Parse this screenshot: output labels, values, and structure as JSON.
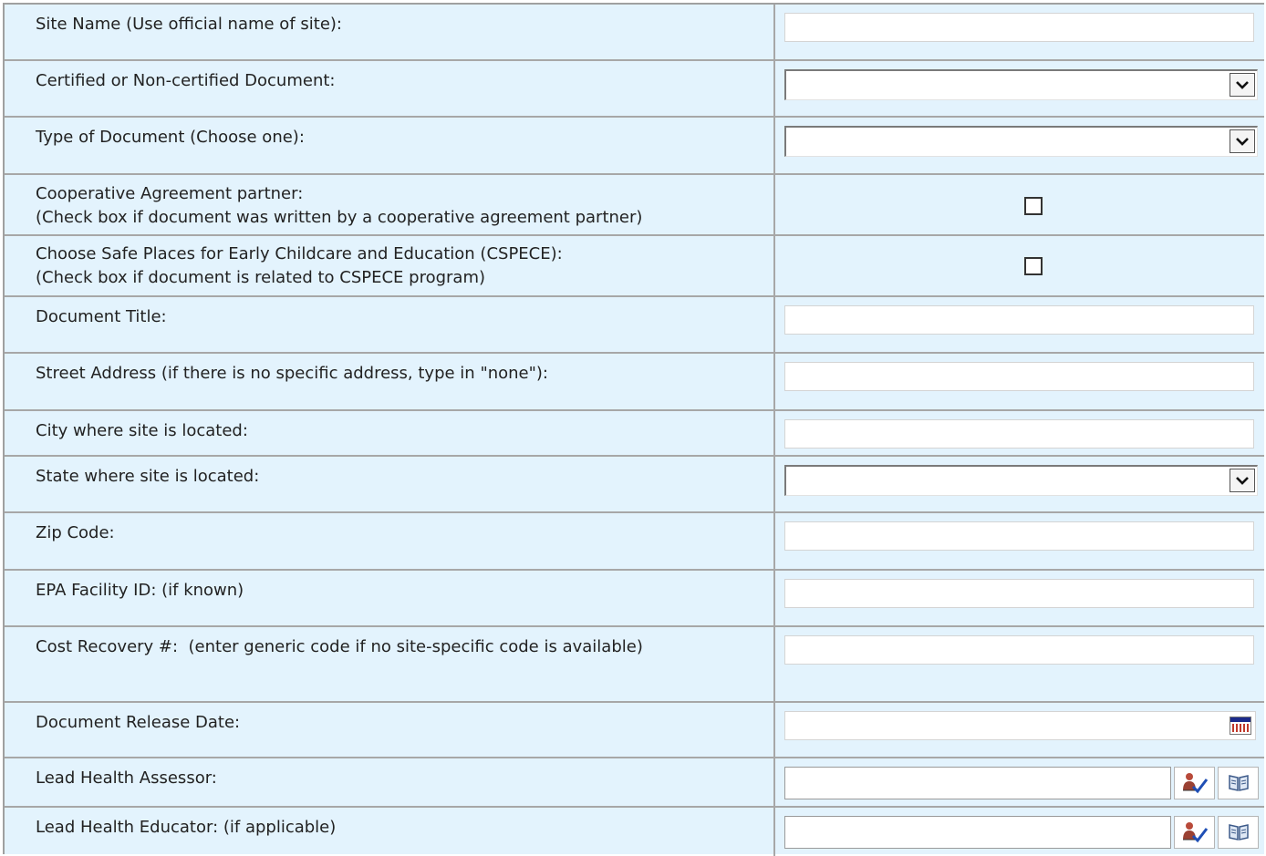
{
  "fields": {
    "site_name": {
      "label": "Site Name (Use official name of site):",
      "value": ""
    },
    "certified": {
      "label": "Certified or Non-certified Document:",
      "value": ""
    },
    "doc_type": {
      "label": "Type of Document (Choose one):",
      "value": ""
    },
    "coop_partner": {
      "label_line1": "Cooperative Agreement partner:",
      "label_line2": "(Check box if document was written by a cooperative agreement partner)",
      "checked": false
    },
    "cspece": {
      "label_line1": "Choose Safe Places for Early Childcare and Education (CSPECE):",
      "label_line2": "(Check box if document is related to CSPECE program)",
      "checked": false
    },
    "doc_title": {
      "label": "Document Title:",
      "value": ""
    },
    "street": {
      "label": "Street Address (if there is no specific address, type in \"none\"):",
      "value": ""
    },
    "city": {
      "label": "City where site is located:",
      "value": ""
    },
    "state": {
      "label": "State where site is located:",
      "value": ""
    },
    "zip": {
      "label": "Zip Code:",
      "value": ""
    },
    "epa_id": {
      "label": "EPA Facility ID: (if known)",
      "value": ""
    },
    "cost_recovery": {
      "label": "Cost Recovery #:  (enter generic code if no site-specific code is available)",
      "value": ""
    },
    "release_date": {
      "label": "Document Release Date:",
      "value": ""
    },
    "assessor": {
      "label": "Lead Health Assessor:",
      "value": ""
    },
    "educator": {
      "label": "Lead Health Educator: (if applicable)",
      "value": ""
    }
  },
  "icons": {
    "dropdown": "chevron-down-icon",
    "calendar": "calendar-icon",
    "check_names": "check-names-icon",
    "browse": "address-book-icon"
  },
  "colors": {
    "row_background": "#e3f3fd",
    "border": "#a7a7a7",
    "text": "#222222"
  }
}
